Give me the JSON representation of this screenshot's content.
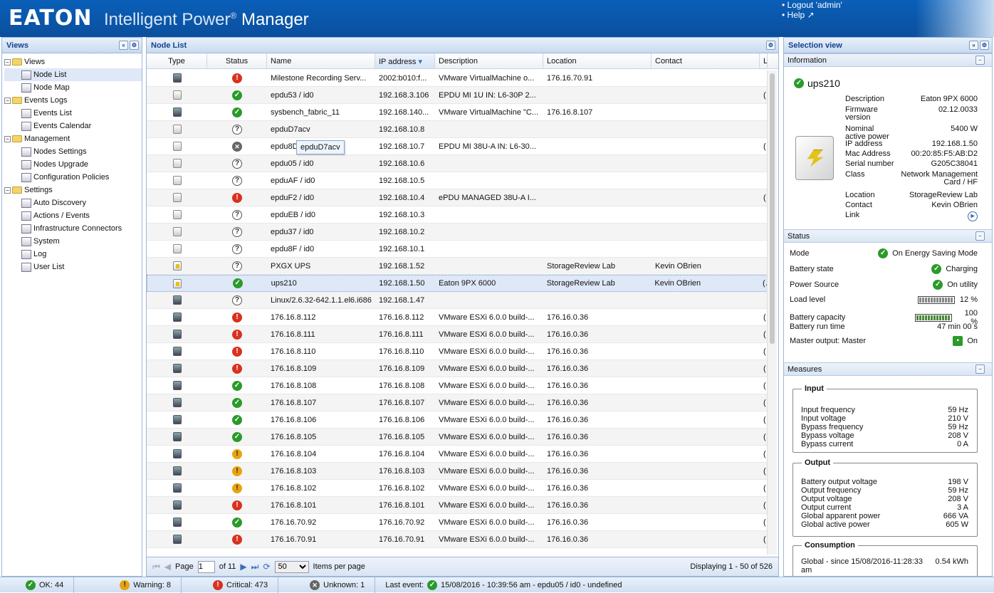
{
  "header": {
    "logo": "EATON",
    "title_prefix": "Intelligent Power",
    "title_reg": "®",
    "title_suffix": "Manager",
    "logout": "• Logout 'admin'",
    "help": "• Help"
  },
  "views": {
    "title": "Views",
    "tree": [
      {
        "label": "Views",
        "level": 0,
        "type": "folder"
      },
      {
        "label": "Node List",
        "level": 1,
        "type": "item",
        "selected": true
      },
      {
        "label": "Node Map",
        "level": 1,
        "type": "item"
      },
      {
        "label": "Events Logs",
        "level": 0,
        "type": "folder"
      },
      {
        "label": "Events List",
        "level": 1,
        "type": "item"
      },
      {
        "label": "Events Calendar",
        "level": 1,
        "type": "item"
      },
      {
        "label": "Management",
        "level": 0,
        "type": "folder"
      },
      {
        "label": "Nodes Settings",
        "level": 1,
        "type": "item"
      },
      {
        "label": "Nodes Upgrade",
        "level": 1,
        "type": "item"
      },
      {
        "label": "Configuration Policies",
        "level": 1,
        "type": "item"
      },
      {
        "label": "Settings",
        "level": 0,
        "type": "folder"
      },
      {
        "label": "Auto Discovery",
        "level": 1,
        "type": "item"
      },
      {
        "label": "Actions / Events",
        "level": 1,
        "type": "item"
      },
      {
        "label": "Infrastructure Connectors",
        "level": 1,
        "type": "item"
      },
      {
        "label": "System",
        "level": 1,
        "type": "item"
      },
      {
        "label": "Log",
        "level": 1,
        "type": "item"
      },
      {
        "label": "User List",
        "level": 1,
        "type": "item"
      }
    ]
  },
  "nodelist": {
    "title": "Node List",
    "columns": [
      "Type",
      "Status",
      "Name",
      "IP address",
      "Description",
      "Location",
      "Contact",
      "L"
    ],
    "tooltip": "epduD7acv",
    "rows": [
      {
        "type": "vm",
        "status": "crit",
        "name": "Milestone Recording Serv...",
        "ip": "2002:b010:f...",
        "desc": "VMware VirtualMachine o...",
        "loc": "176.16.70.91",
        "contact": "",
        "l": ""
      },
      {
        "type": "pdu",
        "status": "ok",
        "name": "epdu53 / id0",
        "ip": "192.168.3.106",
        "desc": "EPDU MI 1U IN: L6-30P 2...",
        "loc": "",
        "contact": "",
        "l": "("
      },
      {
        "type": "vm",
        "status": "ok",
        "name": "sysbench_fabric_11",
        "ip": "192.168.140...",
        "desc": "VMware VirtualMachine \"C...",
        "loc": "176.16.8.107",
        "contact": "",
        "l": ""
      },
      {
        "type": "pdu",
        "status": "unk",
        "name": "epduD7acv",
        "ip": "192.168.10.8",
        "desc": "",
        "loc": "",
        "contact": "",
        "l": ""
      },
      {
        "type": "pdu",
        "status": "off",
        "name": "epdu8D",
        "ip": "192.168.10.7",
        "desc": "EPDU MI 38U-A IN: L6-30...",
        "loc": "",
        "contact": "",
        "l": "("
      },
      {
        "type": "pdu",
        "status": "unk",
        "name": "epdu05 / id0",
        "ip": "192.168.10.6",
        "desc": "",
        "loc": "",
        "contact": "",
        "l": ""
      },
      {
        "type": "pdu",
        "status": "unk",
        "name": "epduAF / id0",
        "ip": "192.168.10.5",
        "desc": "",
        "loc": "",
        "contact": "",
        "l": ""
      },
      {
        "type": "pdu",
        "status": "crit",
        "name": "epduF2 / id0",
        "ip": "192.168.10.4",
        "desc": "ePDU MANAGED 38U-A I...",
        "loc": "",
        "contact": "",
        "l": "("
      },
      {
        "type": "pdu",
        "status": "unk",
        "name": "epduEB / id0",
        "ip": "192.168.10.3",
        "desc": "",
        "loc": "",
        "contact": "",
        "l": ""
      },
      {
        "type": "pdu",
        "status": "unk",
        "name": "epdu37 / id0",
        "ip": "192.168.10.2",
        "desc": "",
        "loc": "",
        "contact": "",
        "l": ""
      },
      {
        "type": "pdu",
        "status": "unk",
        "name": "epdu8F / id0",
        "ip": "192.168.10.1",
        "desc": "",
        "loc": "",
        "contact": "",
        "l": ""
      },
      {
        "type": "ups",
        "status": "unk",
        "name": "PXGX UPS",
        "ip": "192.168.1.52",
        "desc": "",
        "loc": "StorageReview Lab",
        "contact": "Kevin OBrien",
        "l": ""
      },
      {
        "type": "ups",
        "status": "ok",
        "name": "ups210",
        "ip": "192.168.1.50",
        "desc": "Eaton 9PX 6000",
        "loc": "StorageReview Lab",
        "contact": "Kevin OBrien",
        "l": "(",
        "selected": true
      },
      {
        "type": "vm",
        "status": "unk",
        "name": "Linux/2.6.32-642.1.1.el6.i686",
        "ip": "192.168.1.47",
        "desc": "",
        "loc": "",
        "contact": "",
        "l": ""
      },
      {
        "type": "vm",
        "status": "crit",
        "name": "176.16.8.112",
        "ip": "176.16.8.112",
        "desc": "VMware ESXi 6.0.0 build-...",
        "loc": "176.16.0.36",
        "contact": "",
        "l": "("
      },
      {
        "type": "vm",
        "status": "crit",
        "name": "176.16.8.111",
        "ip": "176.16.8.111",
        "desc": "VMware ESXi 6.0.0 build-...",
        "loc": "176.16.0.36",
        "contact": "",
        "l": "("
      },
      {
        "type": "vm",
        "status": "crit",
        "name": "176.16.8.110",
        "ip": "176.16.8.110",
        "desc": "VMware ESXi 6.0.0 build-...",
        "loc": "176.16.0.36",
        "contact": "",
        "l": "("
      },
      {
        "type": "vm",
        "status": "crit",
        "name": "176.16.8.109",
        "ip": "176.16.8.109",
        "desc": "VMware ESXi 6.0.0 build-...",
        "loc": "176.16.0.36",
        "contact": "",
        "l": "("
      },
      {
        "type": "vm",
        "status": "ok",
        "name": "176.16.8.108",
        "ip": "176.16.8.108",
        "desc": "VMware ESXi 6.0.0 build-...",
        "loc": "176.16.0.36",
        "contact": "",
        "l": "("
      },
      {
        "type": "vm",
        "status": "ok",
        "name": "176.16.8.107",
        "ip": "176.16.8.107",
        "desc": "VMware ESXi 6.0.0 build-...",
        "loc": "176.16.0.36",
        "contact": "",
        "l": "("
      },
      {
        "type": "vm",
        "status": "ok",
        "name": "176.16.8.106",
        "ip": "176.16.8.106",
        "desc": "VMware ESXi 6.0.0 build-...",
        "loc": "176.16.0.36",
        "contact": "",
        "l": "("
      },
      {
        "type": "vm",
        "status": "ok",
        "name": "176.16.8.105",
        "ip": "176.16.8.105",
        "desc": "VMware ESXi 6.0.0 build-...",
        "loc": "176.16.0.36",
        "contact": "",
        "l": "("
      },
      {
        "type": "vm",
        "status": "warn",
        "name": "176.16.8.104",
        "ip": "176.16.8.104",
        "desc": "VMware ESXi 6.0.0 build-...",
        "loc": "176.16.0.36",
        "contact": "",
        "l": "("
      },
      {
        "type": "vm",
        "status": "warn",
        "name": "176.16.8.103",
        "ip": "176.16.8.103",
        "desc": "VMware ESXi 6.0.0 build-...",
        "loc": "176.16.0.36",
        "contact": "",
        "l": "("
      },
      {
        "type": "vm",
        "status": "warn",
        "name": "176.16.8.102",
        "ip": "176.16.8.102",
        "desc": "VMware ESXi 6.0.0 build-...",
        "loc": "176.16.0.36",
        "contact": "",
        "l": "("
      },
      {
        "type": "vm",
        "status": "crit",
        "name": "176.16.8.101",
        "ip": "176.16.8.101",
        "desc": "VMware ESXi 6.0.0 build-...",
        "loc": "176.16.0.36",
        "contact": "",
        "l": "("
      },
      {
        "type": "vm",
        "status": "ok",
        "name": "176.16.70.92",
        "ip": "176.16.70.92",
        "desc": "VMware ESXi 6.0.0 build-...",
        "loc": "176.16.0.36",
        "contact": "",
        "l": "("
      },
      {
        "type": "vm",
        "status": "crit",
        "name": "176.16.70.91",
        "ip": "176.16.70.91",
        "desc": "VMware ESXi 6.0.0 build-...",
        "loc": "176.16.0.36",
        "contact": "",
        "l": "("
      }
    ],
    "pager": {
      "page_label": "Page",
      "page_value": "1",
      "of_label": "of 11",
      "per_page": "50",
      "per_page_label": "Items per page",
      "displaying": "Displaying 1 - 50 of 526"
    }
  },
  "selection": {
    "title": "Selection view",
    "info_title": "Information",
    "device_name": "ups210",
    "info": [
      {
        "k": "Description",
        "v": "Eaton 9PX 6000"
      },
      {
        "k": "Firmware version",
        "v": "02.12.0033"
      },
      {
        "k": "Nominal active power",
        "v": "5400 W"
      },
      {
        "k": "IP address",
        "v": "192.168.1.50"
      },
      {
        "k": "Mac Address",
        "v": "00:20:85:F5:AB:D2"
      },
      {
        "k": "Serial number",
        "v": "G205C38041"
      },
      {
        "k": "Class",
        "v": "Network Management Card / HF"
      },
      {
        "k": "Location",
        "v": "StorageReview Lab"
      },
      {
        "k": "Contact",
        "v": "Kevin OBrien"
      },
      {
        "k": "Link",
        "v": ""
      }
    ],
    "status_title": "Status",
    "status": {
      "mode_k": "Mode",
      "mode_v": "On Energy Saving Mode",
      "batt_state_k": "Battery state",
      "batt_state_v": "Charging",
      "power_source_k": "Power Source",
      "power_source_v": "On utility",
      "load_k": "Load level",
      "load_v": "12 %",
      "load_pct": 12,
      "cap_k": "Battery capacity",
      "cap_v": "100 %",
      "cap_pct": 100,
      "runtime_k": "Battery run time",
      "runtime_v": "47 min 00 s",
      "master_k": "Master output: Master",
      "master_v": "On"
    },
    "measures_title": "Measures",
    "input_title": "Input",
    "input": [
      {
        "k": "Input frequency",
        "v": "59 Hz"
      },
      {
        "k": "Input voltage",
        "v": "210 V"
      },
      {
        "k": "Bypass frequency",
        "v": "59 Hz"
      },
      {
        "k": "Bypass voltage",
        "v": "208 V"
      },
      {
        "k": "Bypass current",
        "v": "0 A"
      }
    ],
    "output_title": "Output",
    "output": [
      {
        "k": "Battery output voltage",
        "v": "198 V"
      },
      {
        "k": "Output frequency",
        "v": "59 Hz"
      },
      {
        "k": "Output voltage",
        "v": "208 V"
      },
      {
        "k": "Output current",
        "v": "3 A"
      },
      {
        "k": "Global apparent power",
        "v": "666 VA"
      },
      {
        "k": "Global active power",
        "v": "605 W"
      }
    ],
    "consumption_title": "Consumption",
    "consumption": [
      {
        "k": "Global - since 15/08/2016-11:28:33 am",
        "v": "0.54 kWh"
      }
    ]
  },
  "statusbar": {
    "ok": "OK: 44",
    "warning": "Warning: 8",
    "critical": "Critical: 473",
    "unknown": "Unknown: 1",
    "last_event_label": "Last event:",
    "last_event": "15/08/2016 - 10:39:56 am - epdu05 / id0 - undefined"
  },
  "colors": {
    "header": "#0b5fb3",
    "ok": "#2a9a2a",
    "critical": "#d9311f",
    "warning": "#e8a313"
  }
}
